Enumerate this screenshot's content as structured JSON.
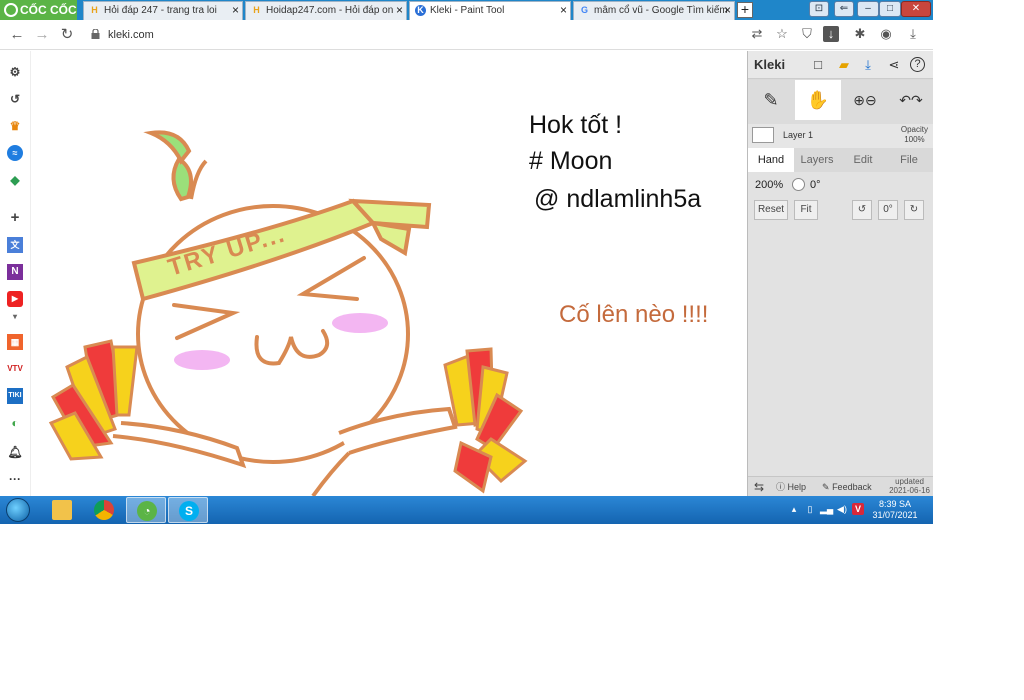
{
  "browser": {
    "brand": "CỐC CỐC",
    "tabs": [
      {
        "title": "Hỏi đáp 247 - trang tra loi",
        "favicon": "H"
      },
      {
        "title": "Hoidap247.com - Hỏi đáp on",
        "favicon": "H"
      },
      {
        "title": "Kleki - Paint Tool",
        "favicon": "K"
      },
      {
        "title": "mâm cổ vũ - Google Tìm kiếm",
        "favicon": "G"
      }
    ],
    "address": "kleki.com"
  },
  "canvas": {
    "headband_text": "TRY UP...",
    "notes": [
      "Hok tốt !",
      "# Moon",
      "@ ndlamlinh5a",
      "Cố lên nèo !!!!"
    ]
  },
  "kleki": {
    "logo": "Kleki",
    "layer_name": "Layer 1",
    "opacity_label": "Opacity",
    "opacity_value": "100%",
    "tabs": [
      "Hand",
      "Layers",
      "Edit",
      "File"
    ],
    "active_tab": "Hand",
    "zoom": "200%",
    "angle": "0°",
    "reset_label": "Reset",
    "fit_label": "Fit",
    "angle_button": "0°",
    "help_label": "Help",
    "feedback_label": "Feedback",
    "updated_label": "updated",
    "updated_date": "2021-06-16"
  },
  "taskbar": {
    "time": "8:39 SA",
    "date": "31/07/2021"
  },
  "colors": {
    "tabstrip": "#1f86c9",
    "brand_green": "#5bb446",
    "outline_orange": "#d98a52",
    "headband_green": "#dff28f",
    "blush_pink": "#f3b6f2",
    "pompom_red": "#ef3b3b",
    "pompom_yellow": "#f6d21c",
    "note_orange": "#c46a3c"
  }
}
